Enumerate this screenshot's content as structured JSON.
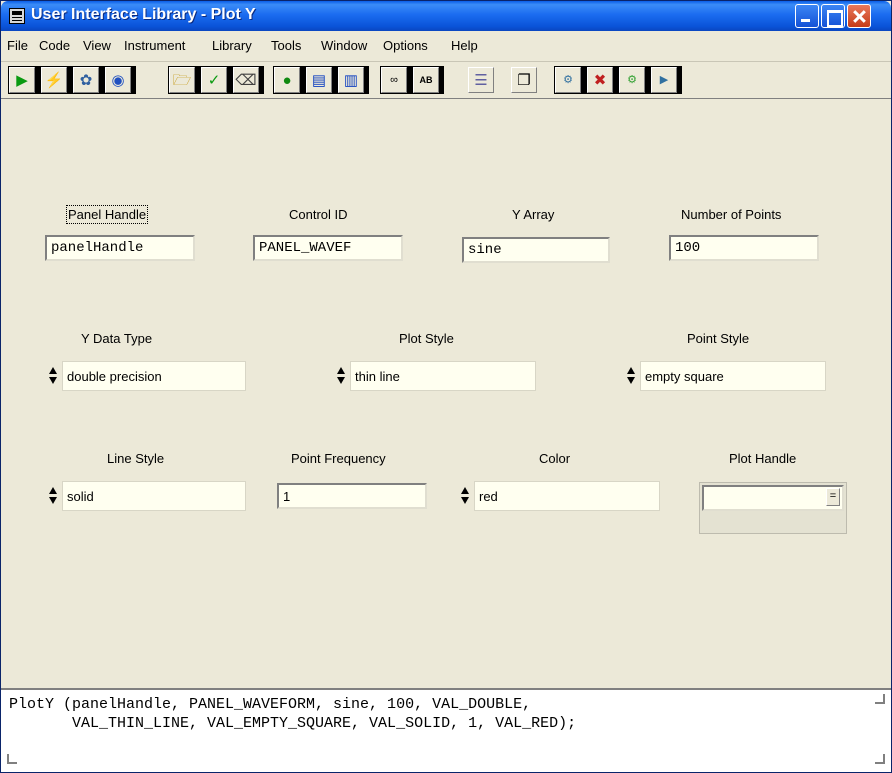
{
  "window": {
    "title": "User Interface Library - Plot Y",
    "icon": "panel-icon"
  },
  "menu": {
    "items": [
      {
        "label": "File"
      },
      {
        "label": "Code"
      },
      {
        "label": "View"
      },
      {
        "label": "Instrument"
      },
      {
        "label": "Library"
      },
      {
        "label": "Tools"
      },
      {
        "label": "Window"
      },
      {
        "label": "Options"
      },
      {
        "label": "Help"
      }
    ]
  },
  "toolbar": {
    "icons": [
      "run-fp-icon",
      "lightning-icon",
      "debug-icon",
      "watch-icon",
      "open-folder-icon",
      "check-icon",
      "eraser-icon",
      "tree-icon",
      "panel-in-icon",
      "panel-out-icon",
      "function-panel-icon",
      "function-panel-ab-icon",
      "list-icon",
      "copy-icon",
      "bp-icon",
      "bp-clear-icon",
      "bp-set-icon",
      "bp-go-icon"
    ]
  },
  "fields": {
    "panel_handle": {
      "label": "Panel Handle",
      "value": "panelHandle"
    },
    "control_id": {
      "label": "Control ID",
      "value": "PANEL_WAVEF"
    },
    "y_array": {
      "label": "Y Array",
      "value": "sine"
    },
    "num_points": {
      "label": "Number of Points",
      "value": "100"
    },
    "y_data_type": {
      "label": "Y Data Type",
      "value": "double precision"
    },
    "plot_style": {
      "label": "Plot Style",
      "value": "thin line"
    },
    "point_style": {
      "label": "Point Style",
      "value": "empty square"
    },
    "line_style": {
      "label": "Line Style",
      "value": "solid"
    },
    "point_frequency": {
      "label": "Point Frequency",
      "value": "1"
    },
    "color": {
      "label": "Color",
      "value": "red"
    },
    "plot_handle": {
      "label": "Plot Handle",
      "value": ""
    }
  },
  "code": {
    "line1": "PlotY (panelHandle, PANEL_WAVEFORM, sine, 100, VAL_DOUBLE,",
    "line2": "       VAL_THIN_LINE, VAL_EMPTY_SQUARE, VAL_SOLID, 1, VAL_RED);"
  },
  "colors": {
    "titlebar": "#0a5ee8",
    "panel_bg": "#ece9d8",
    "field_bg": "#fffff0"
  }
}
